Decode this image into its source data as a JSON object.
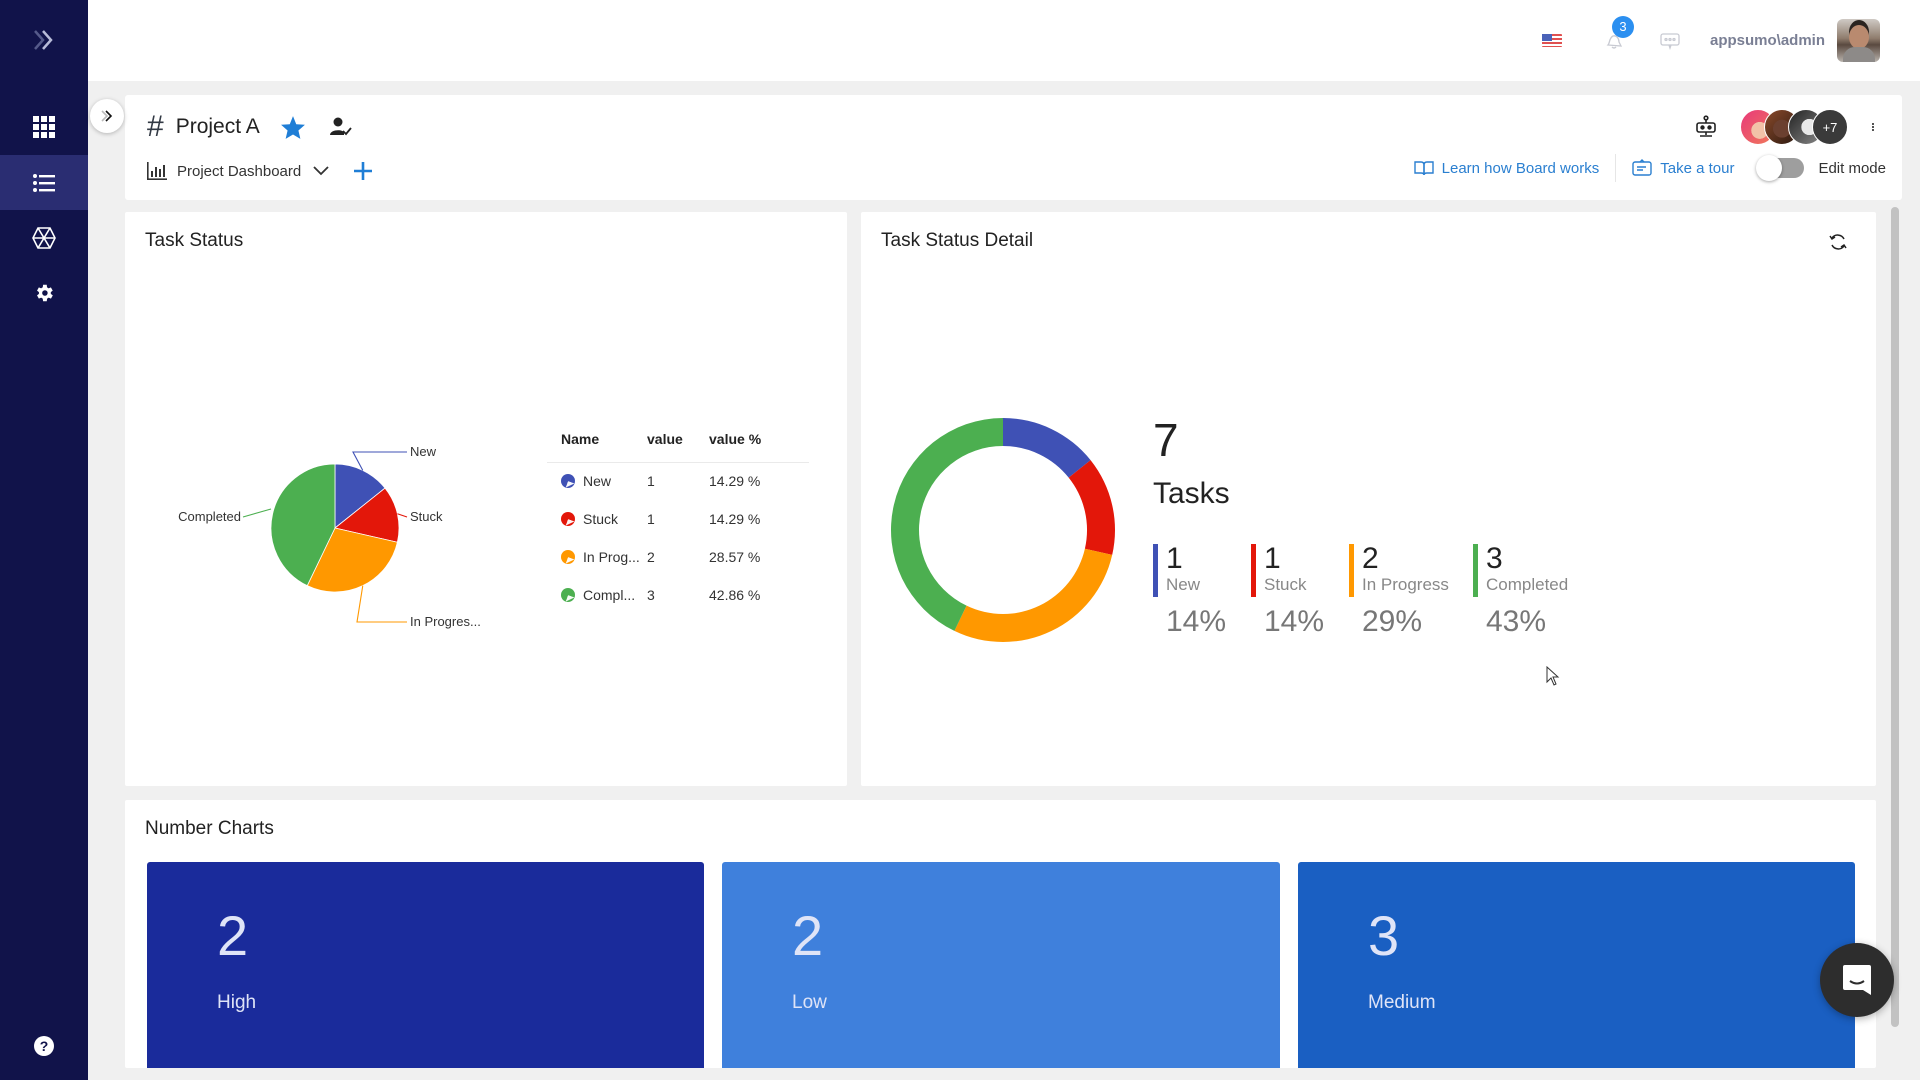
{
  "topbar": {
    "language_icon": "us-flag-icon",
    "notifications_count": "3",
    "username": "appsumo\\admin"
  },
  "sidebar": {
    "items": [
      {
        "name": "expand",
        "icon": "double-chevron-right-icon"
      },
      {
        "name": "apps",
        "icon": "grid-icon"
      },
      {
        "name": "boards",
        "icon": "list-icon",
        "active": true
      },
      {
        "name": "network",
        "icon": "hexagon-network-icon"
      },
      {
        "name": "settings",
        "icon": "gear-icon"
      },
      {
        "name": "help",
        "icon": "help-circle-icon"
      }
    ]
  },
  "project": {
    "title": "Project A",
    "hash": "#",
    "view_name": "Project Dashboard",
    "members_more": "+7",
    "learn_link": "Learn how Board works",
    "tour_link": "Take a tour",
    "edit_mode_label": "Edit mode",
    "edit_mode_on": false
  },
  "colors": {
    "new": "#3f51b5",
    "stuck": "#e3170a",
    "in_progress": "#ff9800",
    "completed": "#4caf50",
    "accent": "#2a7fd0"
  },
  "task_status": {
    "title": "Task Status",
    "table": {
      "headers": [
        "Name",
        "value",
        "value %"
      ],
      "rows": [
        {
          "name": "New",
          "value": "1",
          "pct": "14.29 %"
        },
        {
          "name": "Stuck",
          "value": "1",
          "pct": "14.29 %"
        },
        {
          "name": "In Prog...",
          "value": "2",
          "pct": "28.57 %"
        },
        {
          "name": "Compl...",
          "value": "3",
          "pct": "42.86 %"
        }
      ]
    }
  },
  "task_detail": {
    "title": "Task Status Detail",
    "total": "7",
    "total_label": "Tasks",
    "items": [
      {
        "value": "1",
        "name": "New",
        "pct": "14%"
      },
      {
        "value": "1",
        "name": "Stuck",
        "pct": "14%"
      },
      {
        "value": "2",
        "name": "In Progress",
        "pct": "29%"
      },
      {
        "value": "3",
        "name": "Completed",
        "pct": "43%"
      }
    ]
  },
  "number_charts": {
    "title": "Number Charts",
    "tiles": [
      {
        "value": "2",
        "label": "High",
        "color": "#1a2b9b"
      },
      {
        "value": "2",
        "label": "Low",
        "color": "#3f80dc"
      },
      {
        "value": "3",
        "label": "Medium",
        "color": "#1a5fc2"
      }
    ]
  },
  "chart_data": [
    {
      "type": "pie",
      "title": "Task Status",
      "categories": [
        "New",
        "Stuck",
        "In Progress",
        "Completed"
      ],
      "slice_labels": [
        "New",
        "Stuck",
        "In Progres...",
        "Completed"
      ],
      "values": [
        1,
        1,
        2,
        3
      ],
      "percent": [
        14.29,
        14.29,
        28.57,
        42.86
      ],
      "colors": [
        "#3f51b5",
        "#e3170a",
        "#ff9800",
        "#4caf50"
      ]
    },
    {
      "type": "pie",
      "subtype": "donut",
      "title": "Task Status Detail",
      "categories": [
        "New",
        "Stuck",
        "In Progress",
        "Completed"
      ],
      "values": [
        1,
        1,
        2,
        3
      ],
      "percent": [
        14,
        14,
        29,
        43
      ],
      "total": 7,
      "colors": [
        "#3f51b5",
        "#e3170a",
        "#ff9800",
        "#4caf50"
      ]
    }
  ]
}
